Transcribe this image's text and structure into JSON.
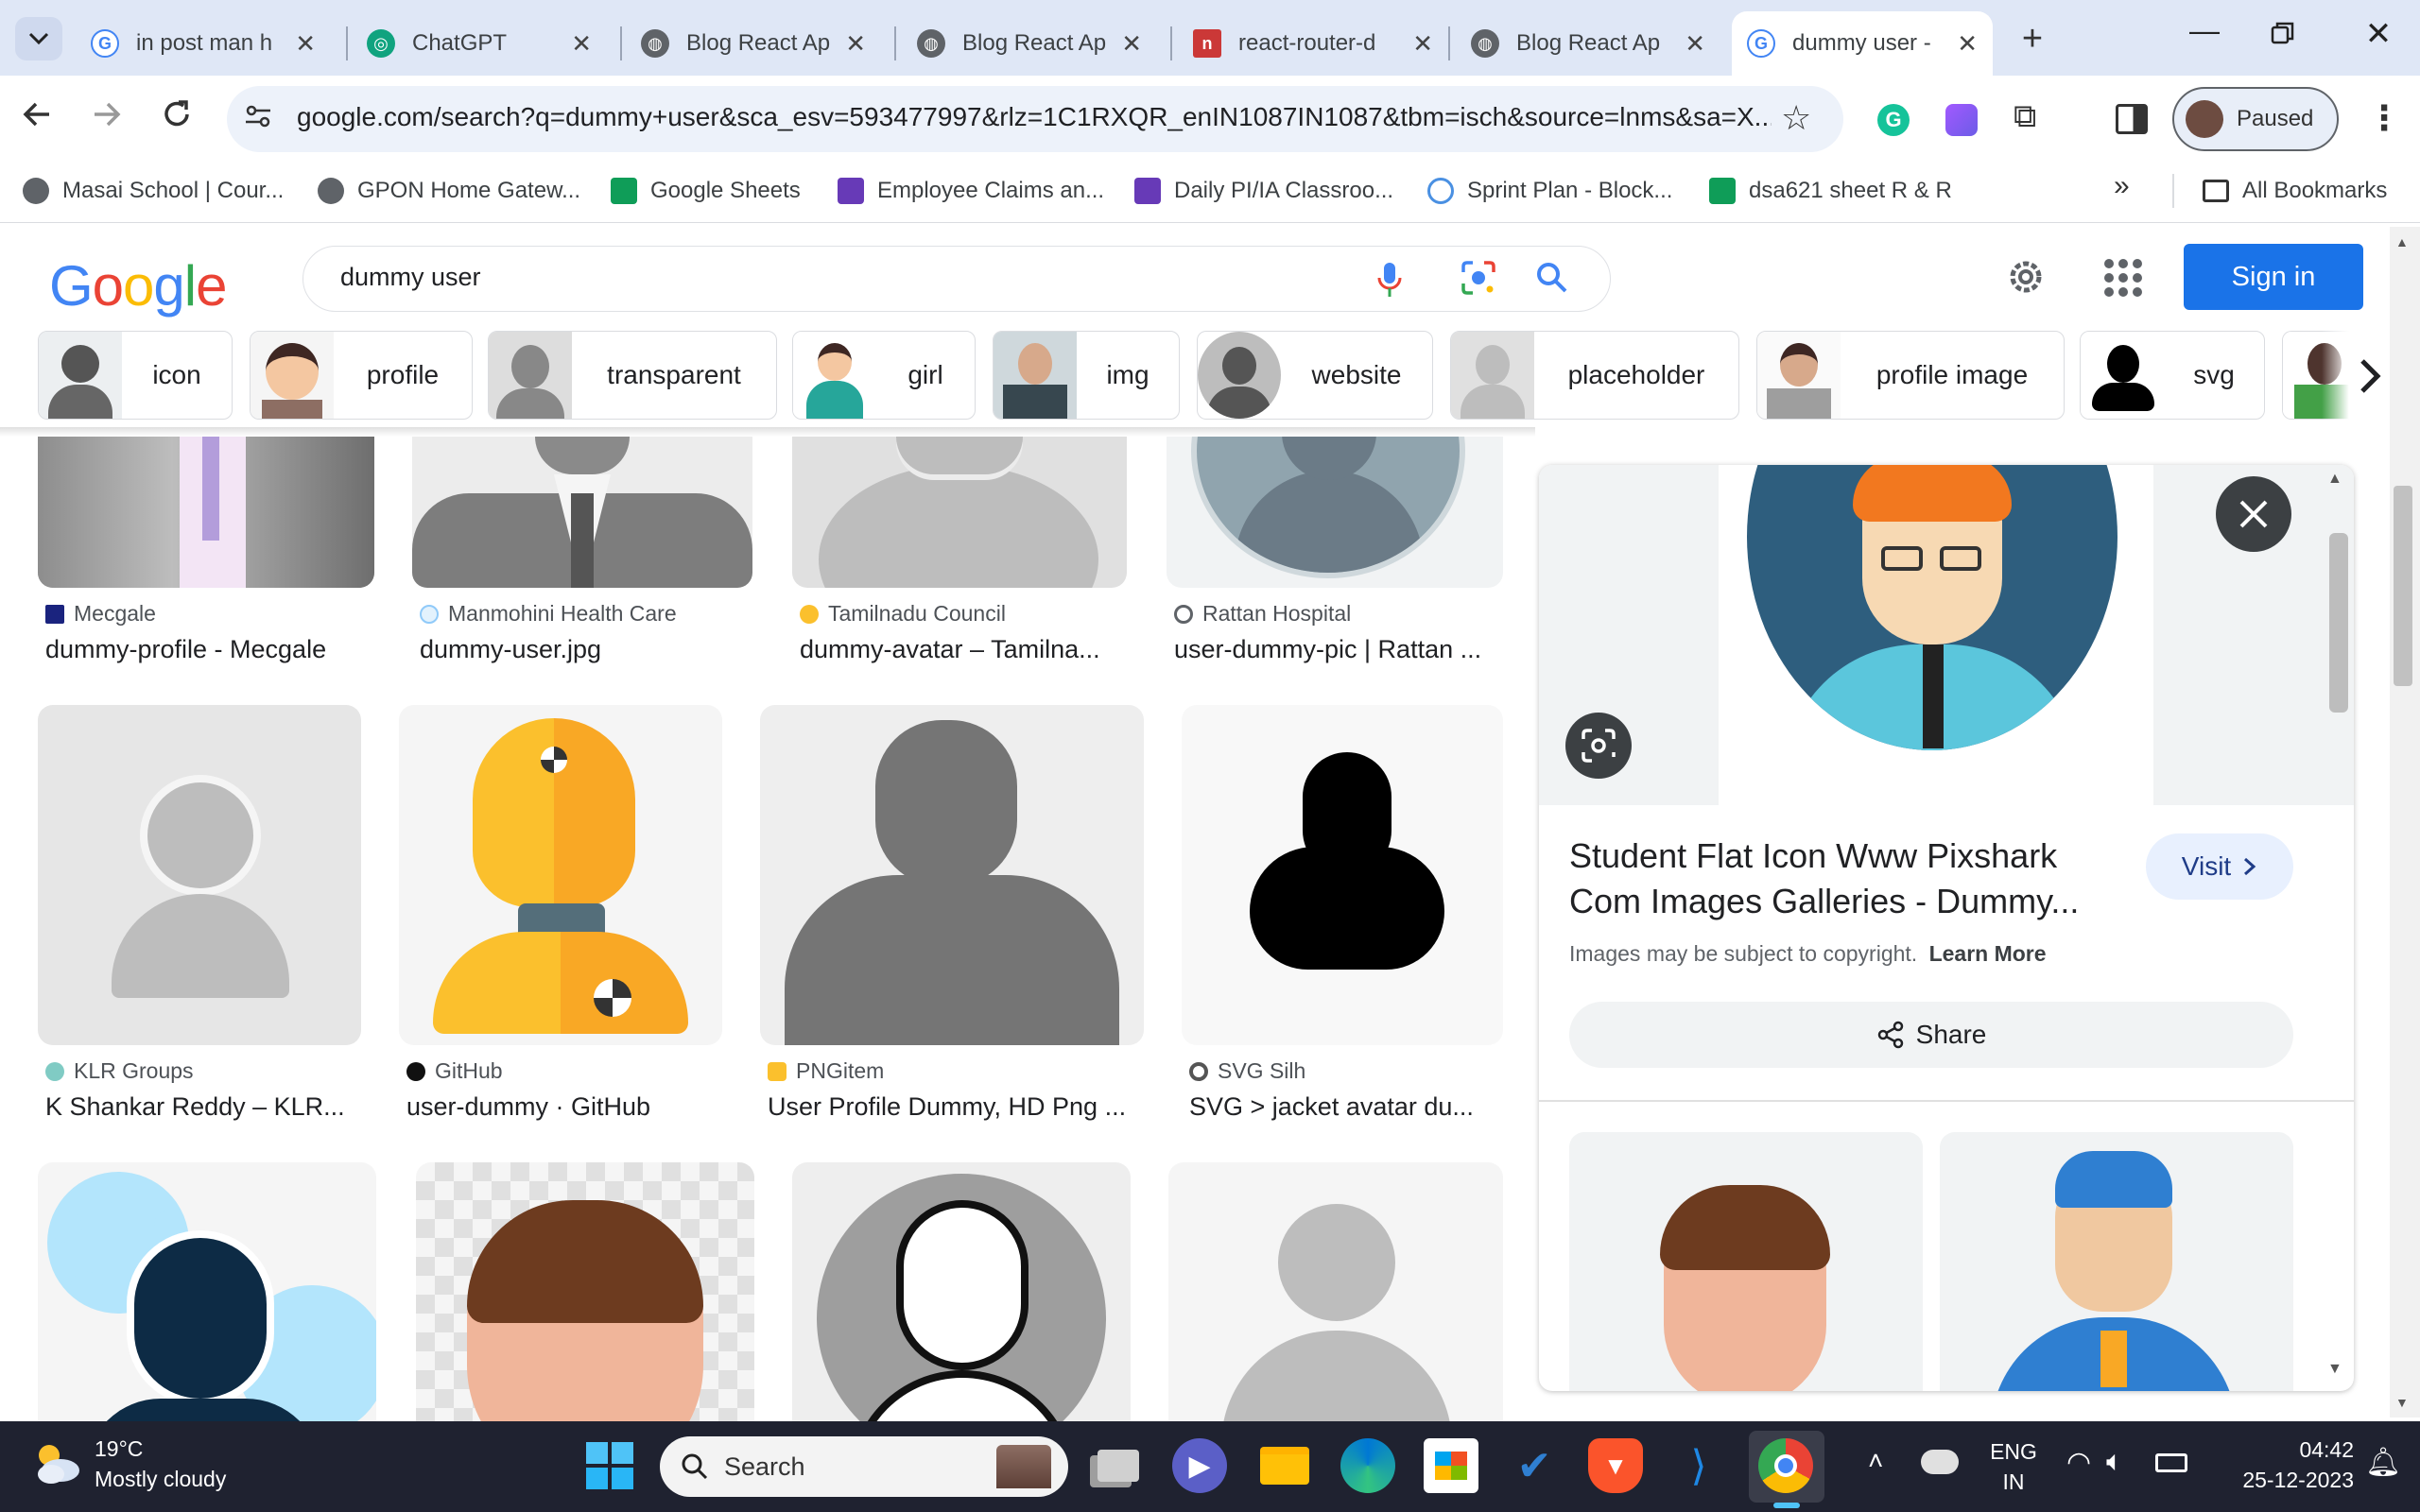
{
  "browser": {
    "tabs": [
      {
        "title": "in post man h",
        "icon": "google-icon",
        "active": false
      },
      {
        "title": "ChatGPT",
        "icon": "chatgpt-icon",
        "active": false
      },
      {
        "title": "Blog React Ap",
        "icon": "globe-icon",
        "active": false
      },
      {
        "title": "Blog React Ap",
        "icon": "globe-icon",
        "active": false
      },
      {
        "title": "react-router-d",
        "icon": "npm-icon",
        "active": false
      },
      {
        "title": "Blog React Ap",
        "icon": "globe-icon",
        "active": false
      },
      {
        "title": "dummy user -",
        "icon": "google-icon",
        "active": true
      }
    ],
    "url": "google.com/search?q=dummy+user&sca_esv=593477997&rlz=1C1RXQR_enIN1087IN1087&tbm=isch&source=lnms&sa=X...",
    "profile_label": "Paused",
    "bookmarks": [
      "Masai School | Cour...",
      "GPON Home Gatew...",
      "Google Sheets",
      "Employee Claims an...",
      "Daily PI/IA Classroo...",
      "Sprint Plan -  Block...",
      "dsa621 sheet R & R"
    ],
    "all_bookmarks": "All Bookmarks"
  },
  "google": {
    "logo": "Google",
    "query": "dummy user",
    "signin": "Sign in",
    "chips": [
      "icon",
      "profile",
      "transparent",
      "girl",
      "img",
      "website",
      "placeholder",
      "profile image",
      "svg"
    ]
  },
  "results": [
    {
      "source": "Mecgale",
      "title": "dummy-profile - Mecgale"
    },
    {
      "source": "Manmohini Health Care",
      "title": "dummy-user.jpg"
    },
    {
      "source": "Tamilnadu Council",
      "title": "dummy-avatar – Tamilna..."
    },
    {
      "source": "Rattan Hospital",
      "title": "user-dummy-pic | Rattan ..."
    },
    {
      "source": "KLR Groups",
      "title": "K Shankar Reddy – KLR..."
    },
    {
      "source": "GitHub",
      "title": "user-dummy · GitHub"
    },
    {
      "source": "PNGitem",
      "title": "User Profile Dummy, HD Png ..."
    },
    {
      "source": "SVG Silh",
      "title": "SVG > jacket avatar du..."
    }
  ],
  "panel": {
    "title": "Student Flat Icon Www Pixshark Com Images Galleries - Dummy...",
    "visit": "Visit",
    "copyright": "Images may be subject to copyright.",
    "learn_more": "Learn More",
    "share": "Share"
  },
  "taskbar": {
    "temp": "19°C",
    "weather": "Mostly cloudy",
    "search": "Search",
    "lang1": "ENG",
    "lang2": "IN",
    "time": "04:42",
    "date": "25-12-2023"
  }
}
